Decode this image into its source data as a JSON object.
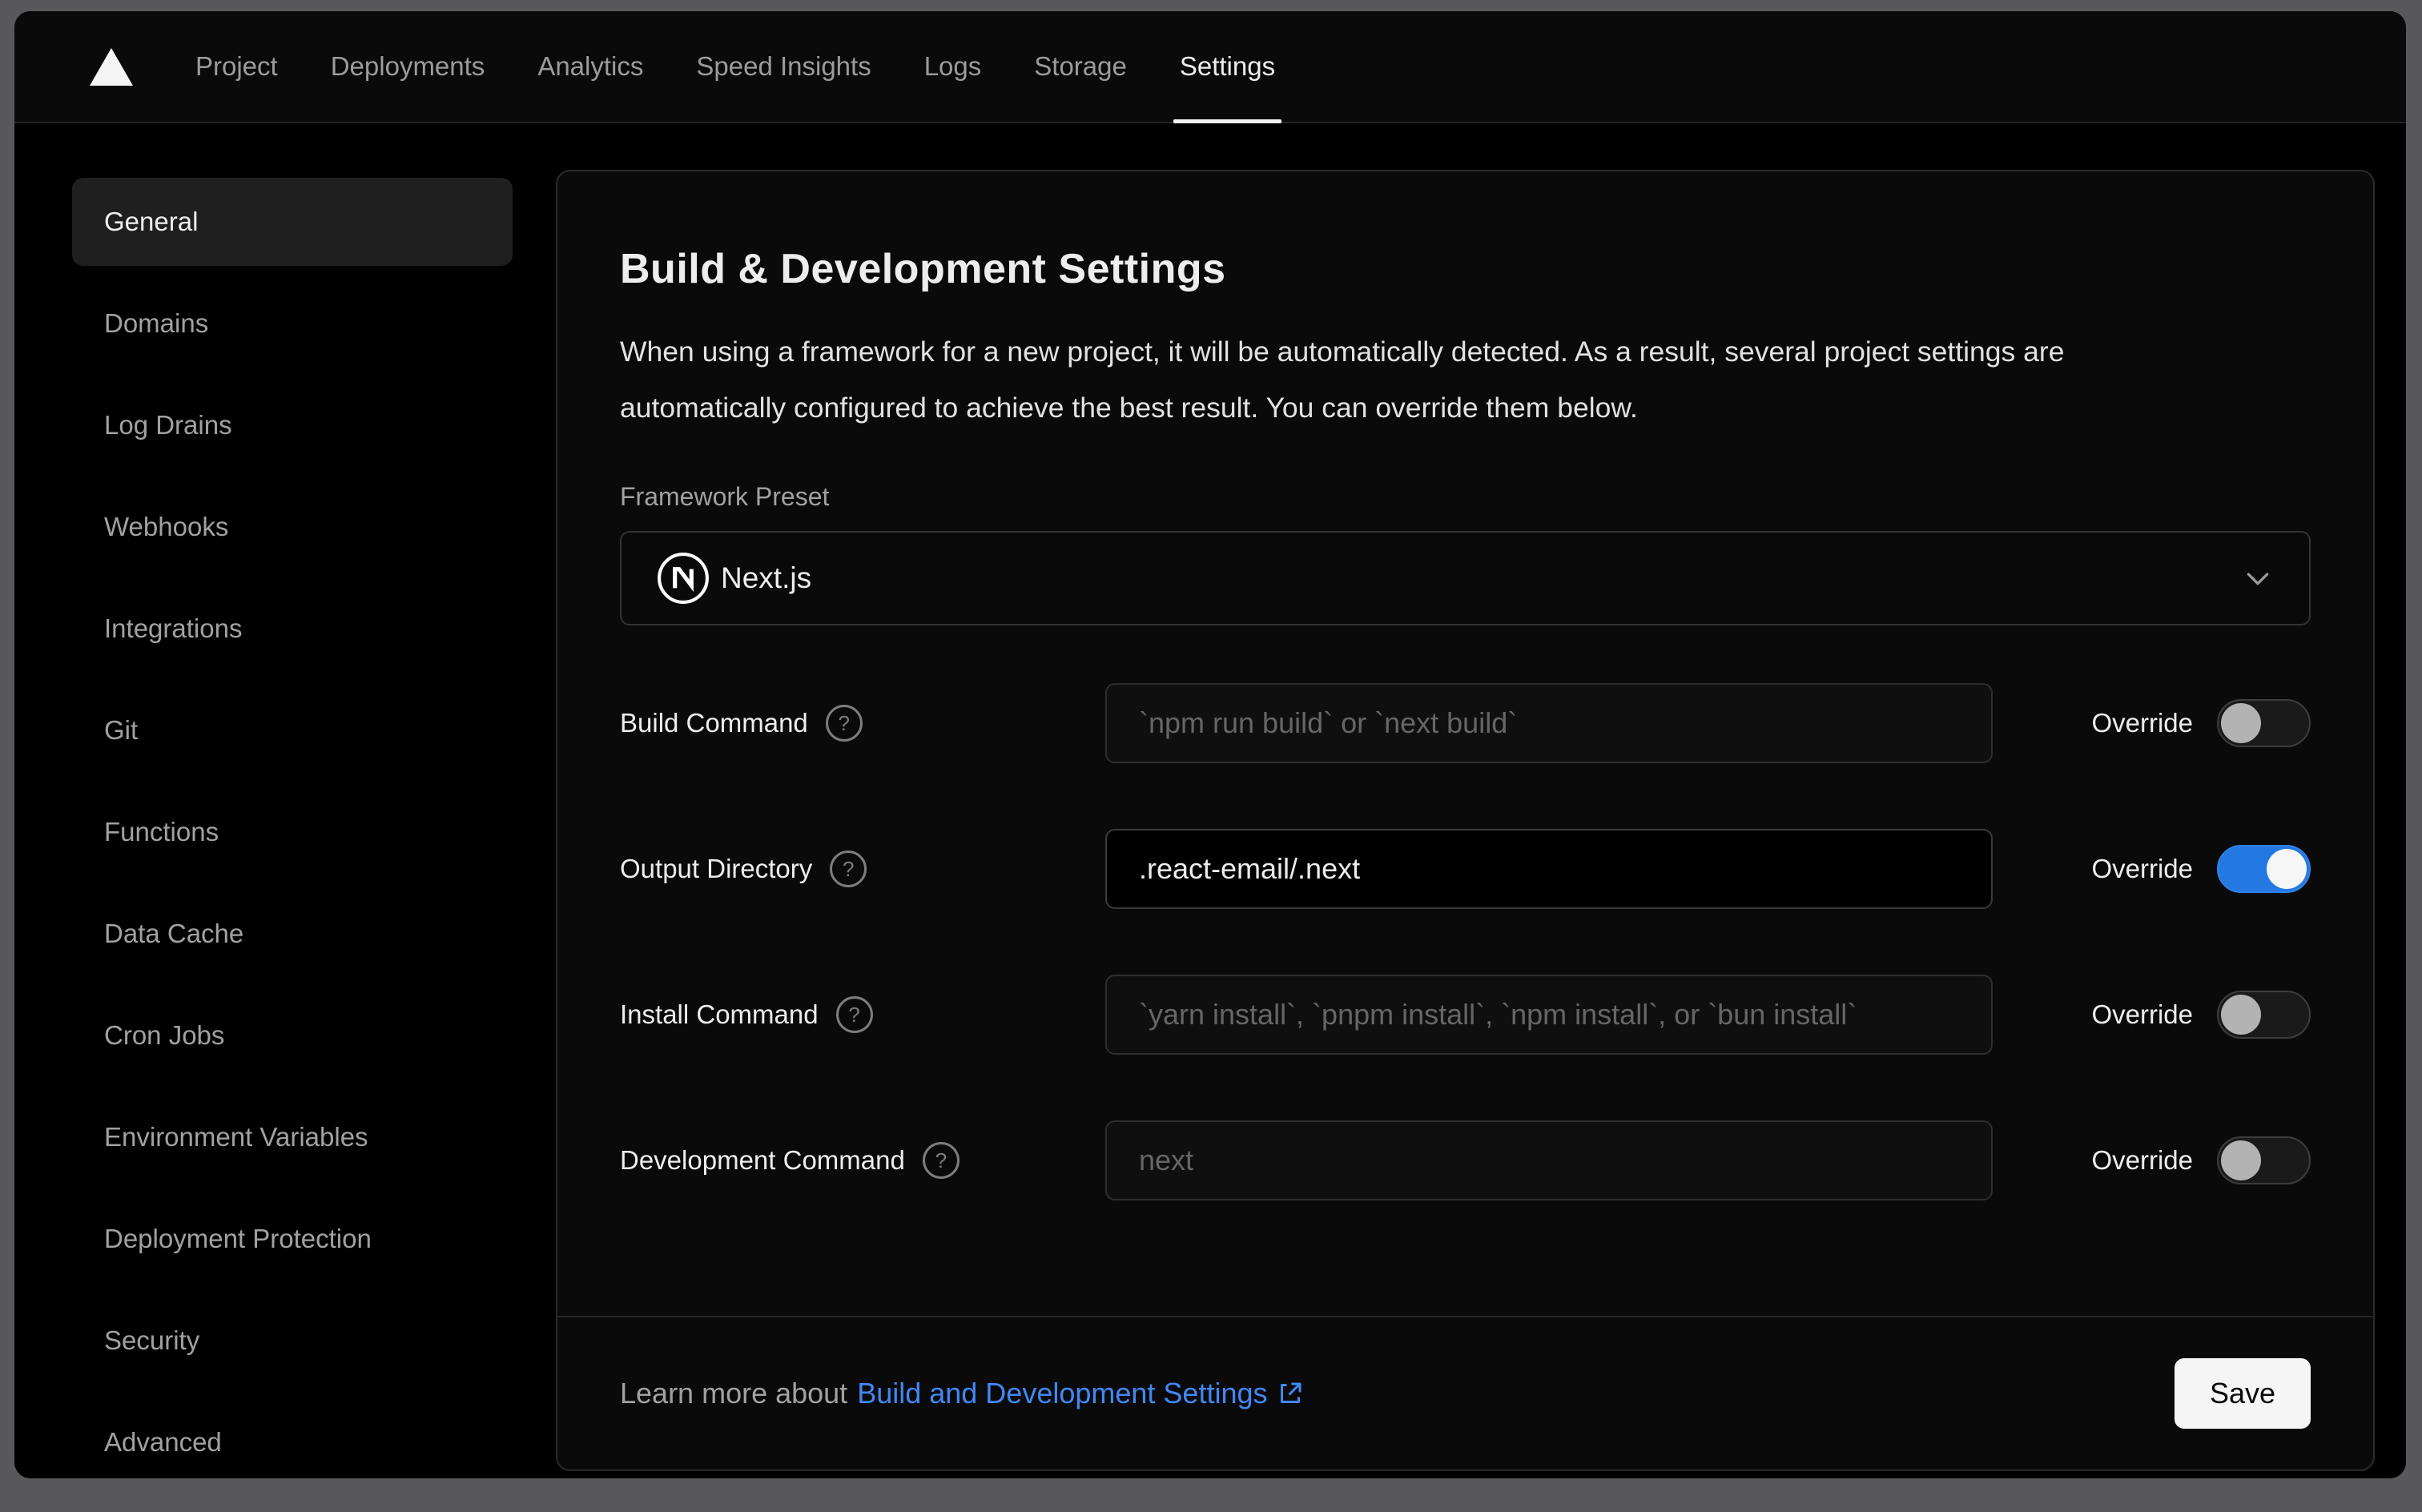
{
  "nav": {
    "logo": "vercel-triangle-logo",
    "tabs": [
      {
        "label": "Project",
        "active": false
      },
      {
        "label": "Deployments",
        "active": false
      },
      {
        "label": "Analytics",
        "active": false
      },
      {
        "label": "Speed Insights",
        "active": false
      },
      {
        "label": "Logs",
        "active": false
      },
      {
        "label": "Storage",
        "active": false
      },
      {
        "label": "Settings",
        "active": true
      }
    ]
  },
  "sidebar": {
    "items": [
      {
        "label": "General",
        "active": true
      },
      {
        "label": "Domains",
        "active": false
      },
      {
        "label": "Log Drains",
        "active": false
      },
      {
        "label": "Webhooks",
        "active": false
      },
      {
        "label": "Integrations",
        "active": false
      },
      {
        "label": "Git",
        "active": false
      },
      {
        "label": "Functions",
        "active": false
      },
      {
        "label": "Data Cache",
        "active": false
      },
      {
        "label": "Cron Jobs",
        "active": false
      },
      {
        "label": "Environment Variables",
        "active": false
      },
      {
        "label": "Deployment Protection",
        "active": false
      },
      {
        "label": "Security",
        "active": false
      },
      {
        "label": "Advanced",
        "active": false
      }
    ]
  },
  "card": {
    "title": "Build & Development Settings",
    "description": "When using a framework for a new project, it will be automatically detected. As a result, several project settings are automatically configured to achieve the best result. You can override them below.",
    "framework": {
      "label": "Framework Preset",
      "value": "Next.js",
      "icon": "nextjs-logo",
      "chevron": "chevron-down-icon"
    },
    "override_label": "Override",
    "rows": [
      {
        "label": "Build Command",
        "placeholder": "`npm run build` or `next build`",
        "value": "",
        "override": false
      },
      {
        "label": "Output Directory",
        "placeholder": "",
        "value": ".react-email/.next",
        "override": true
      },
      {
        "label": "Install Command",
        "placeholder": "`yarn install`, `pnpm install`, `npm install`, or `bun install`",
        "value": "",
        "override": false
      },
      {
        "label": "Development Command",
        "placeholder": "next",
        "value": "",
        "override": false
      }
    ],
    "footer": {
      "learn_more_prefix": "Learn more about",
      "link_text": "Build and Development Settings",
      "link_icon": "external-link-icon",
      "save_label": "Save"
    }
  },
  "colors": {
    "toggle_on": "#2378e1",
    "link_blue": "#4287f5",
    "window_bg": "#000000",
    "card_bg": "#0a0a0a",
    "outer_frame": "#58585a",
    "active_pill": "#1f1f1f",
    "save_button_bg": "#f5f5f5"
  }
}
